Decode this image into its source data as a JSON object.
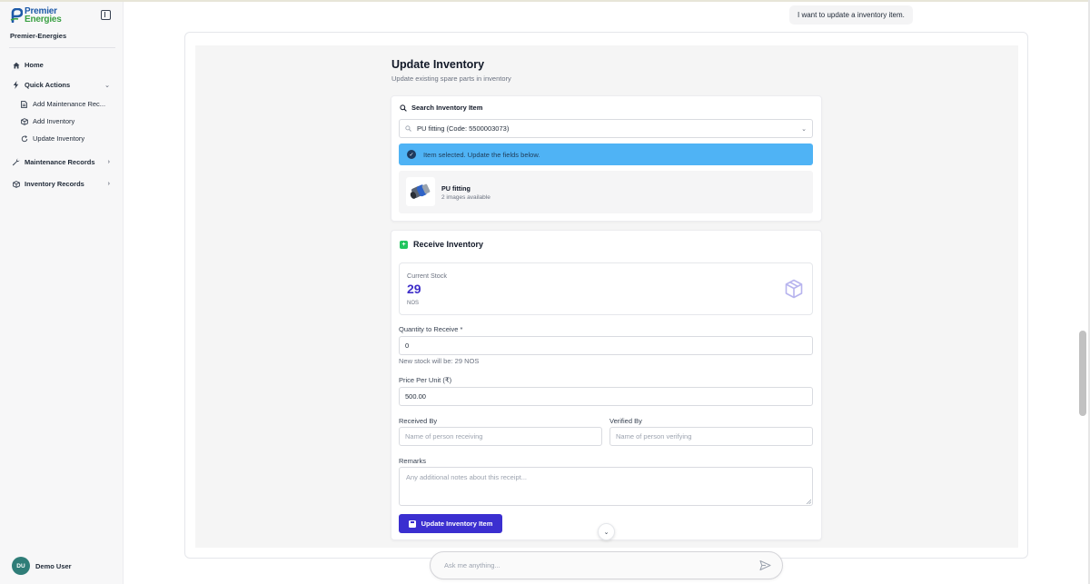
{
  "brand": {
    "line1": "Premier",
    "line2": "Energies",
    "org": "Premier-Energies"
  },
  "nav": {
    "home": "Home",
    "quick_actions": "Quick Actions",
    "sub": [
      "Add Maintenance Rec...",
      "Add Inventory",
      "Update Inventory"
    ],
    "maintenance_records": "Maintenance Records",
    "inventory_records": "Inventory Records"
  },
  "user": {
    "initials": "DU",
    "name": "Demo User"
  },
  "chat": {
    "user_message": "I want to update a inventory item.",
    "input_placeholder": "Ask me anything..."
  },
  "page": {
    "title": "Update Inventory",
    "subtitle": "Update existing spare parts in inventory"
  },
  "search": {
    "title": "Search Inventory Item",
    "selected": "PU fitting (Code: 5500003073)",
    "alert": "Item selected. Update the fields below.",
    "item_name": "PU fitting",
    "item_meta": "2 images available"
  },
  "receive": {
    "title": "Receive Inventory",
    "current_stock_label": "Current Stock",
    "current_stock": "29",
    "unit": "NOS",
    "qty_label": "Quantity to Receive *",
    "qty_value": "0",
    "new_stock": "New stock will be: 29 NOS",
    "price_label": "Price Per Unit (₹)",
    "price_value": "500.00",
    "received_by_label": "Received By",
    "received_by_placeholder": "Name of person receiving",
    "verified_by_label": "Verified By",
    "verified_by_placeholder": "Name of person verifying",
    "remarks_label": "Remarks",
    "remarks_placeholder": "Any additional notes about this receipt...",
    "submit": "Update Inventory Item"
  },
  "colors": {
    "accent": "#3b2fd0",
    "alert": "#4fb3f5",
    "stock": "#3f2fc9",
    "avatar": "#2f7d78"
  }
}
